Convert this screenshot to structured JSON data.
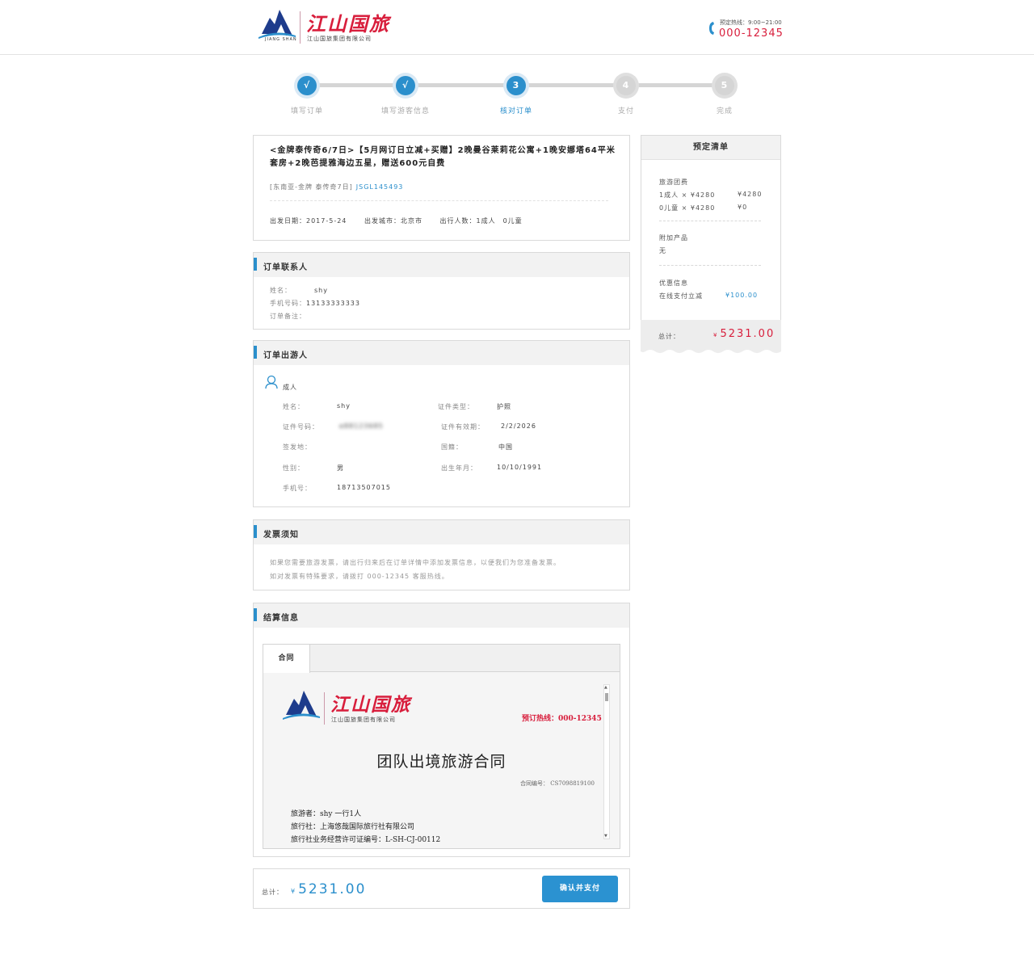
{
  "header": {
    "brand_title": "江山国旅",
    "brand_sub": "江山国旅集团有限公司",
    "hotline_label": "预定热线：9:00~21:00",
    "hotline_number": "000-12345"
  },
  "steps": [
    {
      "icon": "√",
      "label": "填写订单",
      "state": "done"
    },
    {
      "icon": "√",
      "label": "填写游客信息",
      "state": "done"
    },
    {
      "icon": "3",
      "label": "核对订单",
      "state": "current"
    },
    {
      "icon": "4",
      "label": "支付",
      "state": "todo"
    },
    {
      "icon": "5",
      "label": "完成",
      "state": "todo"
    }
  ],
  "trip": {
    "title": "<金牌泰传奇6/7日>【5月网订日立减+买赠】2晚曼谷莱莉花公寓+1晚安娜塔64平米套房+2晚芭提雅海边五星，赠送600元自费",
    "category": "[东南亚-金牌 泰传奇7日]",
    "code": "JSGL145493",
    "depart_date": "出发日期：2017-5-24",
    "depart_city": "出发城市：北京市",
    "people": "出行人数：1成人　0儿童"
  },
  "contact": {
    "title": "订单联系人",
    "name_label": "姓名：",
    "name": "shy",
    "phone_label": "手机号码：",
    "phone": "13133333333",
    "note_label": "订单备注："
  },
  "travelers": {
    "title": "订单出游人",
    "type": "成人",
    "name_label": "姓名：",
    "name": "shy",
    "doc_type_label": "证件类型：",
    "doc_type": "护照",
    "doc_no_label": "证件号码：",
    "doc_no": "e88123685",
    "expiry_label": "证件有效期：",
    "expiry": "2/2/2026",
    "issue_place_label": "签发地：",
    "nationality_label": "国籍：",
    "nationality": "中国",
    "gender_label": "性别：",
    "gender": "男",
    "birth_label": "出生年月：",
    "birth": "10/10/1991",
    "mobile_label": "手机号：",
    "mobile": "18713507015"
  },
  "invoice": {
    "title": "发票须知",
    "line1": "如果您需要旅游发票，请出行归来后在订单详情中添加发票信息，以便我们为您准备发票。",
    "line2": "如对发票有特殊要求，请拨打 000-12345 客服热线。"
  },
  "settlement": {
    "title": "结算信息",
    "tab": "合同",
    "doc_hotline": "预订热线：000-12345",
    "doc_title": "团队出境旅游合同",
    "doc_no": "合同编号： CS7098819100",
    "line1": "旅游者：shy 一行1人",
    "line2": "旅行社：上海悠哉国际旅行社有限公司",
    "line3": "旅行社业务经营许可证编号：L-SH-CJ-00112"
  },
  "footer": {
    "total_label": "总计：",
    "yen": "¥",
    "total": "5231.00",
    "pay_button": "确认并支付"
  },
  "receipt": {
    "title": "预定清单",
    "group_fee_label": "旅游团费",
    "adult_line": "1成人 × ¥4280",
    "adult_total": "¥4280",
    "child_line": "0儿童 × ¥4280",
    "child_total": "¥0",
    "addon_label": "附加产品",
    "addon_value": "无",
    "discount_label": "优惠信息",
    "discount_item": "在线支付立减",
    "discount_value": "¥100.00",
    "total_label": "总计：",
    "yen": "¥",
    "total": "5231.00"
  },
  "colors": {
    "accent": "#2b8fcc",
    "brand_red": "#d81e3c",
    "border": "#dadada",
    "panel_head": "#f2f2f2"
  }
}
